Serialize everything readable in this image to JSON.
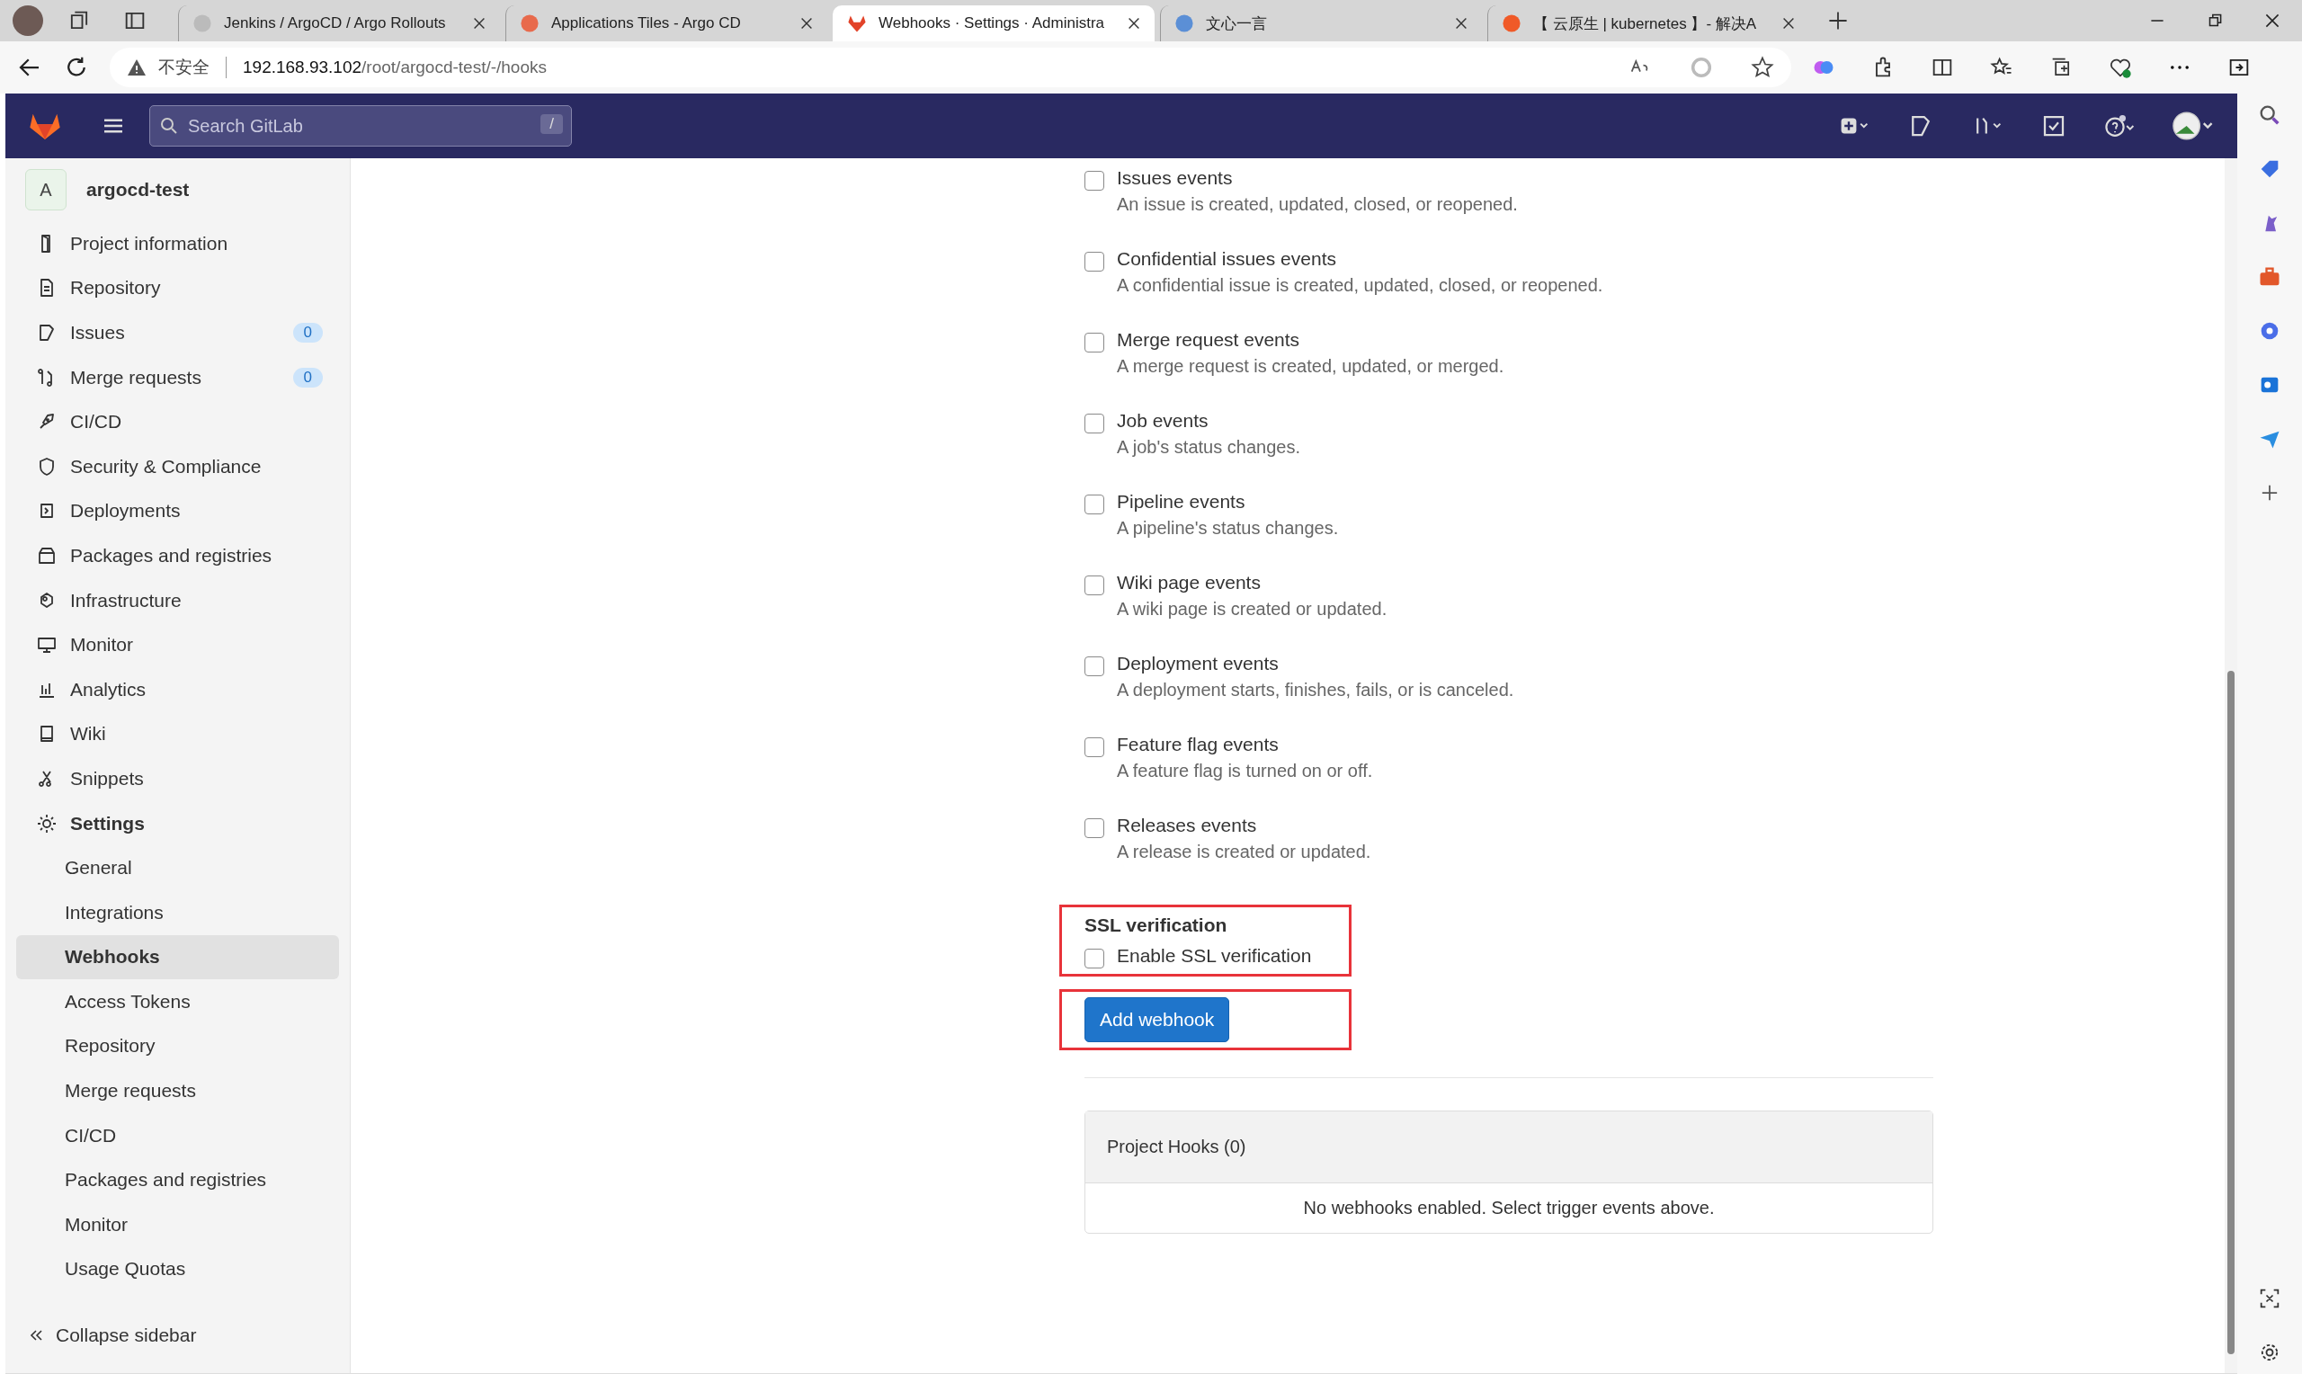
{
  "browser": {
    "tabs": [
      {
        "title": "Jenkins / ArgoCD / Argo Rollouts",
        "selected": false
      },
      {
        "title": "Applications Tiles - Argo CD",
        "selected": false
      },
      {
        "title": "Webhooks · Settings · Administra",
        "selected": true
      },
      {
        "title": "文心一言",
        "selected": false
      },
      {
        "title": "【 云原生 | kubernetes 】- 解决A",
        "selected": false
      }
    ],
    "address": {
      "warning": "不安全",
      "host": "192.168.93.102",
      "path": "/root/argocd-test/-/hooks"
    }
  },
  "header": {
    "search": {
      "placeholder": "Search GitLab",
      "shortcut": "/"
    }
  },
  "sidebar": {
    "project": {
      "avatar": "A",
      "name": "argocd-test"
    },
    "items": [
      {
        "label": "Project information",
        "selected": false
      },
      {
        "label": "Repository",
        "selected": false
      },
      {
        "label": "Issues",
        "count": "0",
        "selected": false
      },
      {
        "label": "Merge requests",
        "count": "0",
        "selected": false
      },
      {
        "label": "CI/CD",
        "selected": false
      },
      {
        "label": "Security & Compliance",
        "selected": false
      },
      {
        "label": "Deployments",
        "selected": false
      },
      {
        "label": "Packages and registries",
        "selected": false
      },
      {
        "label": "Infrastructure",
        "selected": false
      },
      {
        "label": "Monitor",
        "selected": false
      },
      {
        "label": "Analytics",
        "selected": false
      },
      {
        "label": "Wiki",
        "selected": false
      },
      {
        "label": "Snippets",
        "selected": false
      },
      {
        "label": "Settings",
        "selected": false,
        "expanded": true,
        "children": [
          {
            "label": "General",
            "selected": false
          },
          {
            "label": "Integrations",
            "selected": false
          },
          {
            "label": "Webhooks",
            "selected": true
          },
          {
            "label": "Access Tokens",
            "selected": false
          },
          {
            "label": "Repository",
            "selected": false
          },
          {
            "label": "Merge requests",
            "selected": false
          },
          {
            "label": "CI/CD",
            "selected": false
          },
          {
            "label": "Packages and registries",
            "selected": false
          },
          {
            "label": "Monitor",
            "selected": false
          },
          {
            "label": "Usage Quotas",
            "selected": false
          }
        ]
      }
    ],
    "collapse": "Collapse sidebar"
  },
  "events": [
    {
      "label": "Issues events",
      "description": "An issue is created, updated, closed, or reopened.",
      "checked": false
    },
    {
      "label": "Confidential issues events",
      "description": "A confidential issue is created, updated, closed, or reopened.",
      "checked": false
    },
    {
      "label": "Merge request events",
      "description": "A merge request is created, updated, or merged.",
      "checked": false
    },
    {
      "label": "Job events",
      "description": "A job's status changes.",
      "checked": false
    },
    {
      "label": "Pipeline events",
      "description": "A pipeline's status changes.",
      "checked": false
    },
    {
      "label": "Wiki page events",
      "description": "A wiki page is created or updated.",
      "checked": false
    },
    {
      "label": "Deployment events",
      "description": "A deployment starts, finishes, fails, or is canceled.",
      "checked": false
    },
    {
      "label": "Feature flag events",
      "description": "A feature flag is turned on or off.",
      "checked": false
    },
    {
      "label": "Releases events",
      "description": "A release is created or updated.",
      "checked": false
    }
  ],
  "ssl": {
    "heading": "SSL verification",
    "label": "Enable SSL verification",
    "checked": false
  },
  "submit": "Add webhook",
  "hooks": {
    "title": "Project Hooks (0)",
    "empty": "No webhooks enabled. Select trigger events above."
  }
}
